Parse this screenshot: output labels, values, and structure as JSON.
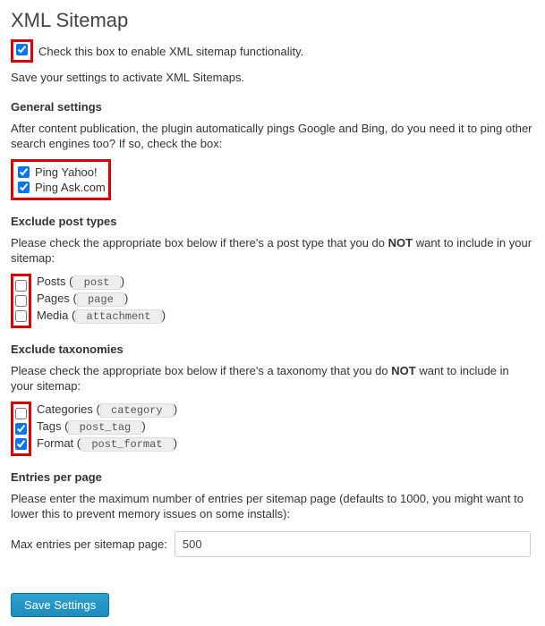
{
  "title": "XML Sitemap",
  "enable": {
    "label": "Check this box to enable XML sitemap functionality."
  },
  "activate_note": "Save your settings to activate XML Sitemaps.",
  "general": {
    "heading": "General settings",
    "desc": "After content publication, the plugin automatically pings Google and Bing, do you need it to ping other search engines too? If so, check the box:",
    "ping_yahoo": "Ping Yahoo!",
    "ping_ask": "Ping Ask.com"
  },
  "exclude_posts": {
    "heading": "Exclude post types",
    "desc_pre": "Please check the appropriate box below if there's a post type that you do ",
    "desc_not": "NOT",
    "desc_post": " want to include in your sitemap:",
    "posts_label": "Posts (",
    "posts_code": " post ",
    "posts_close": ")",
    "pages_label": "Pages (",
    "pages_code": " page ",
    "pages_close": ")",
    "media_label": "Media (",
    "media_code": " attachment ",
    "media_close": ")"
  },
  "exclude_tax": {
    "heading": "Exclude taxonomies",
    "desc_pre": "Please check the appropriate box below if there's a taxonomy that you do ",
    "desc_not": "NOT",
    "desc_post": " want to include in your sitemap:",
    "cat_label": "Categories (",
    "cat_code": " category ",
    "cat_close": ")",
    "tags_label": "Tags (",
    "tags_code": " post_tag ",
    "tags_close": ")",
    "format_label": "Format (",
    "format_code": " post_format ",
    "format_close": ")"
  },
  "entries": {
    "heading": "Entries per page",
    "desc": "Please enter the maximum number of entries per sitemap page (defaults to 1000, you might want to lower this to prevent memory issues on some installs):",
    "label": "Max entries per sitemap page:",
    "value": "500"
  },
  "save_label": "Save Settings"
}
